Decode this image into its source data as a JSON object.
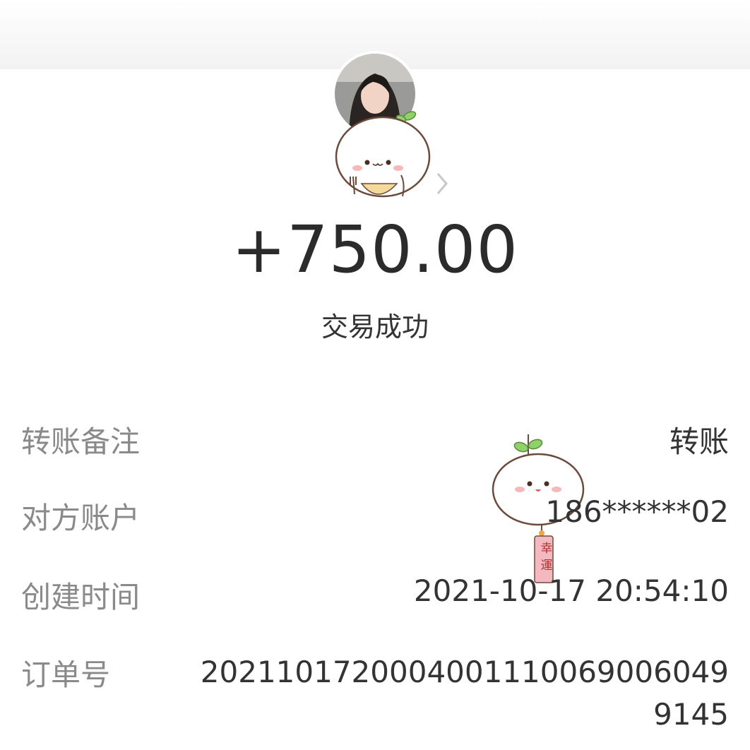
{
  "transaction": {
    "amount": "+750.00",
    "status": "交易成功"
  },
  "details": {
    "remark_label": "转账备注",
    "remark_value": "转账",
    "account_label": "对方账户",
    "account_value": "186******02",
    "created_label": "创建时间",
    "created_value": "2021-10-17 20:54:10",
    "order_label": "订单号",
    "order_value": "20211017200040011100690060499145"
  },
  "stickers": {
    "lucky_charm_text": "幸運"
  },
  "icons": {
    "chevron": "chevron-right-icon",
    "avatar": "user-avatar"
  },
  "colors": {
    "amount_text": "#2b2b2b",
    "label_text": "#8a8a8a",
    "value_text": "#333333",
    "sticker_leaf": "#8fd16b",
    "sticker_charm": "#f4b9c0"
  }
}
